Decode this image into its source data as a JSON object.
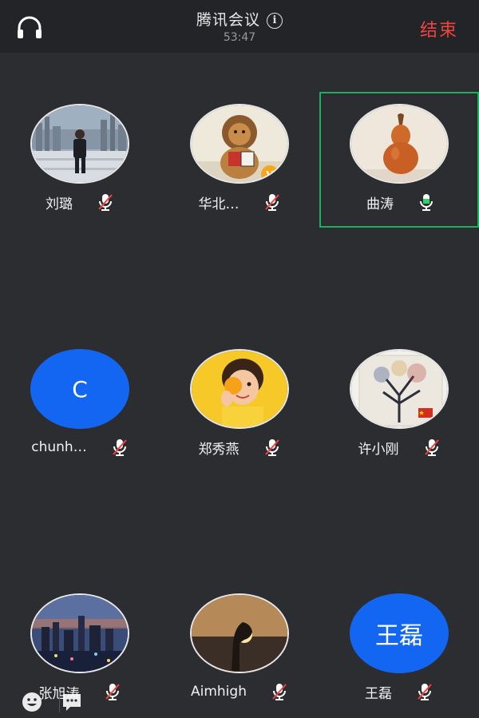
{
  "header": {
    "title": "腾讯会议",
    "timer": "53:47",
    "end_label": "结束",
    "headset_icon": "headset-icon",
    "info_icon": "info-icon"
  },
  "participants": [
    {
      "name": "刘璐",
      "avatar": "photo-city-skyline",
      "mic": "muted"
    },
    {
      "name": "华北…",
      "avatar": "photo-lion-cartoon",
      "mic": "muted",
      "badge": "V"
    },
    {
      "name": "曲涛",
      "avatar": "photo-gourd",
      "mic": "active",
      "speaking": true
    },
    {
      "name": "chunh…",
      "avatar_text": "C",
      "mic": "muted"
    },
    {
      "name": "郑秀燕",
      "avatar": "photo-girl-orange",
      "mic": "muted"
    },
    {
      "name": "许小刚",
      "avatar": "photo-painted-tree",
      "mic": "muted"
    },
    {
      "name": "张旭涛",
      "avatar": "photo-city-night",
      "mic": "muted"
    },
    {
      "name": "Aimhigh",
      "avatar": "photo-sunset-hand",
      "mic": "muted"
    },
    {
      "name": "王磊",
      "avatar_text": "王磊",
      "mic": "muted"
    }
  ],
  "bottom": {
    "emoji_icon": "emoji-icon",
    "chat_icon": "chat-icon"
  },
  "colors": {
    "background": "#2b2d30",
    "topbar": "#232427",
    "end": "#f0433e",
    "avatar_blue": "#1366f2",
    "speaking_border": "#1fae5c",
    "mic_active": "#2bd46a",
    "mic_muted_slash": "#f0433e"
  }
}
